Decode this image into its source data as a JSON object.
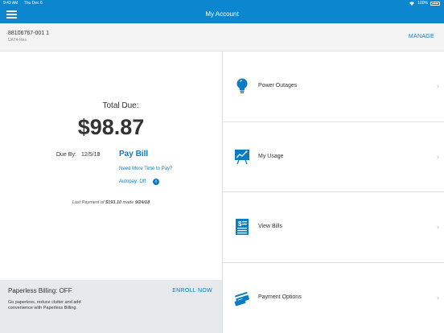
{
  "status_bar": {
    "time": "9:43 AM",
    "date": "Thu Dec 6",
    "battery": "100%"
  },
  "header": {
    "title": "My Account"
  },
  "account": {
    "number": "88106767-001 1",
    "type": "UAT4-Res",
    "manage_label": "MANAGE"
  },
  "bill": {
    "total_label": "Total Due:",
    "total_amount": "$98.87",
    "due_label": "Due By:",
    "due_date": "12/5/18",
    "pay_bill_label": "Pay Bill",
    "more_time_label": "Need More Time to Pay?",
    "autopay_label": "Autopay: Off",
    "last_payment_prefix": "Last Payment of",
    "last_payment_amount": "$193.10",
    "last_payment_mid": "made",
    "last_payment_date": "9/24/18"
  },
  "paperless": {
    "title": "Paperless Billing:  OFF",
    "enroll_label": "ENROLL NOW",
    "description": "Go paperless, reduce clutter and add convenience with Paperless Billing."
  },
  "menu": [
    {
      "label": "Power Outages",
      "icon": "lightbulb-icon"
    },
    {
      "label": "My Usage",
      "icon": "usage-chart-icon"
    },
    {
      "label": "View Bills",
      "icon": "bill-document-icon"
    },
    {
      "label": "Payment Options",
      "icon": "payment-card-icon"
    }
  ],
  "colors": {
    "accent": "#0b86cf",
    "link": "#0b7cc3",
    "paperless_bg": "#e7eaed"
  }
}
